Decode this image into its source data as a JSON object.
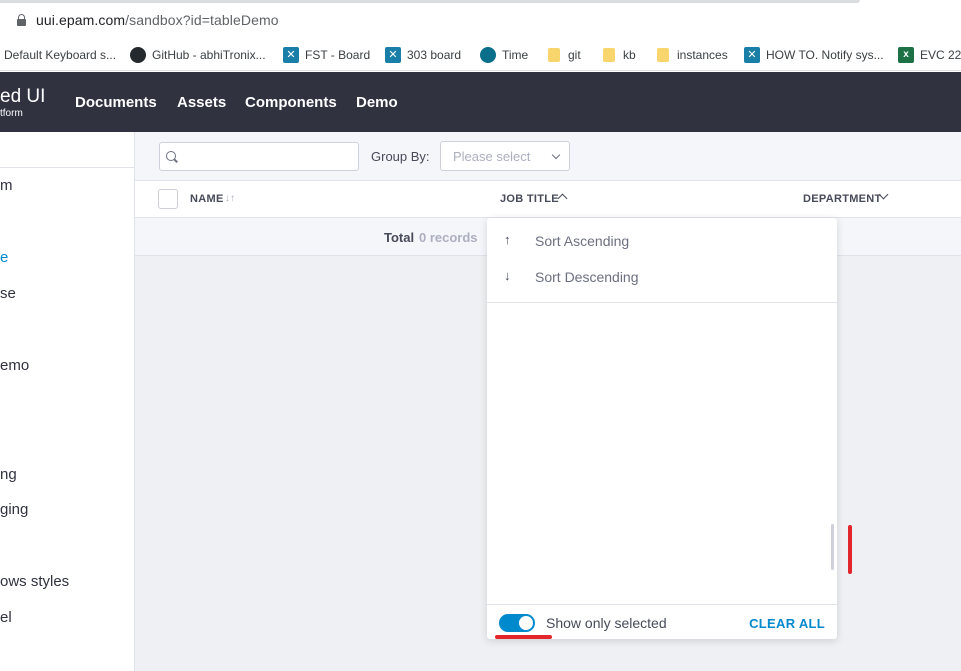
{
  "browser": {
    "url_host": "uui.epam.com",
    "url_path": "/sandbox?id=tableDemo",
    "bookmarks": [
      {
        "label": "Default Keyboard s...",
        "icon": "page-icon"
      },
      {
        "label": "GitHub - abhiTronix...",
        "icon": "github-icon"
      },
      {
        "label": "FST - Board",
        "icon": "jira-icon"
      },
      {
        "label": "303 board",
        "icon": "jira-icon"
      },
      {
        "label": "Time",
        "icon": "clock-icon"
      },
      {
        "label": "git",
        "icon": "folder-icon"
      },
      {
        "label": "kb",
        "icon": "folder-icon"
      },
      {
        "label": "instances",
        "icon": "folder-icon"
      },
      {
        "label": "HOW TO. Notify sys...",
        "icon": "jira-icon"
      },
      {
        "label": "EVC 225",
        "icon": "excel-icon"
      }
    ]
  },
  "header": {
    "logo_line1": "ed UI",
    "logo_line2": "tform",
    "nav": [
      "Documents",
      "Assets",
      "Components",
      "Demo"
    ]
  },
  "sidebar": {
    "items": [
      {
        "label": "m",
        "active": false
      },
      {
        "label": "e",
        "active": true
      },
      {
        "label": "se",
        "active": false
      },
      {
        "label": "emo",
        "active": false
      },
      {
        "label": "ng",
        "active": false
      },
      {
        "label": "ging",
        "active": false
      },
      {
        "label": "ows styles",
        "active": false
      },
      {
        "label": "el",
        "active": false
      }
    ]
  },
  "toolbar": {
    "search_placeholder": "",
    "group_by_label": "Group By:",
    "group_by_placeholder": "Please select"
  },
  "table": {
    "columns": [
      "NAME",
      "JOB TITLE",
      "DEPARTMENT"
    ],
    "total_label": "Total",
    "total_value": "0 records"
  },
  "dropdown": {
    "sort_ascending": "Sort Ascending",
    "sort_descending": "Sort Descending",
    "show_only_selected": "Show only selected",
    "show_only_selected_on": true,
    "clear_all": "CLEAR ALL"
  },
  "colors": {
    "accent": "#008ace",
    "header_bg": "#303240",
    "annotation_red": "#e3262b"
  }
}
